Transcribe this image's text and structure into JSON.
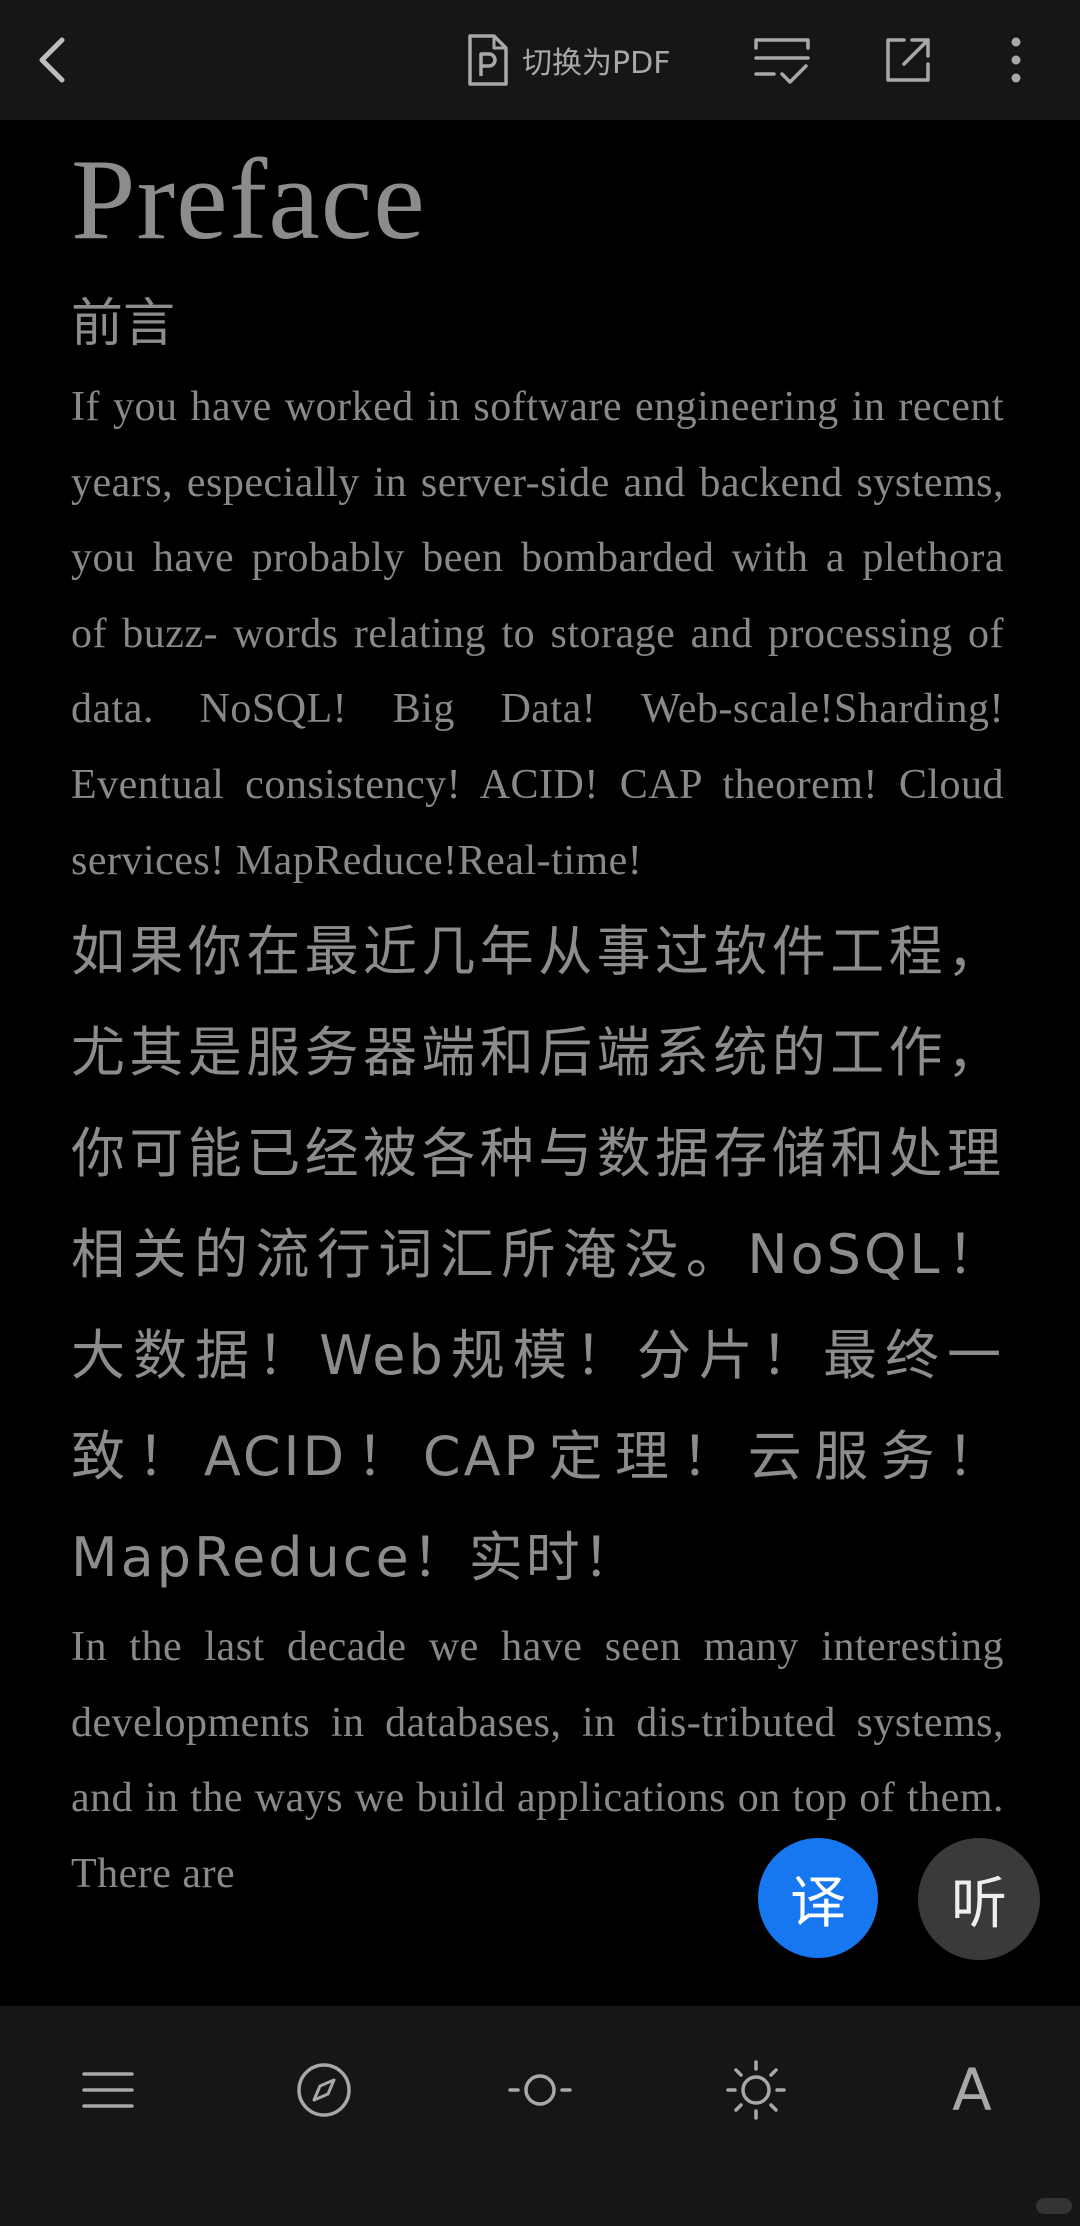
{
  "topbar": {
    "pdf_switch_label": "切换为PDF"
  },
  "content": {
    "title_en": "Preface",
    "title_zh": "前言",
    "para1_en": "If you have worked in software engineering in recent years, especially in server-side and backend systems, you have probably been bombarded with a plethora of buzz- words relating to storage and processing of data. NoSQL! Big Data! Web-scale!Sharding! Eventual consistency! ACID! CAP theorem! Cloud services! MapReduce!Real-time!",
    "para1_zh": "如果你在最近几年从事过软件工程，尤其是服务器端和后端系统的工作，你可能已经被各种与数据存储和处理相关的流行词汇所淹没。NoSQL！大数据！Web规模！分片！最终一致！ACID！CAP定理！云服务！MapReduce！实时！",
    "para2_en": "In the last decade we have seen many interesting developments in databases, in dis-tributed systems, and in the ways we build applications on top of them. There are"
  },
  "fabs": {
    "translate_label": "译",
    "listen_label": "听"
  },
  "bottombar": {
    "font_label": "A"
  },
  "colors": {
    "background": "#000000",
    "bar_background": "#161616",
    "text": "#8a8a8a",
    "translate_accent": "#1677f0",
    "listen_button": "#3a3a3a"
  },
  "icons": [
    "back-icon",
    "pdf-file-icon",
    "notes-icon",
    "share-icon",
    "more-icon",
    "menu-icon",
    "compass-icon",
    "progress-icon",
    "brightness-icon",
    "font-icon"
  ]
}
